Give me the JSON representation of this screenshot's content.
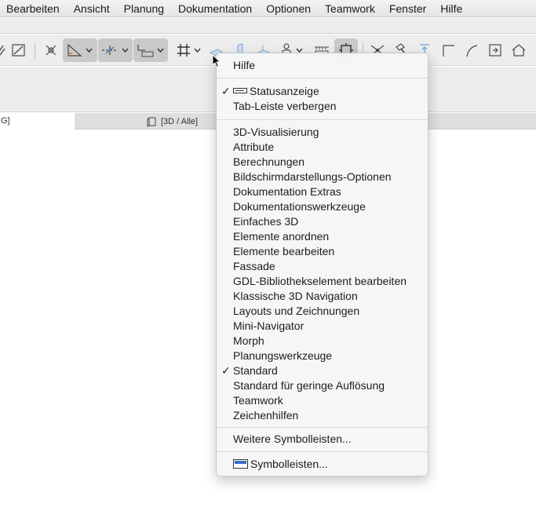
{
  "menubar": {
    "items": [
      "Bearbeiten",
      "Ansicht",
      "Planung",
      "Dokumentation",
      "Optionen",
      "Teamwork",
      "Fenster",
      "Hilfe"
    ]
  },
  "toolbar": {
    "icons": [
      "snap-guides-icon",
      "magic-wand-icon",
      "intersection-icon",
      "ruler-angle-icon",
      "guideline-icon",
      "coordinate-input-icon",
      "grid-snap-icon",
      "plane-icon",
      "vertical-plane-icon",
      "ortho-plane-icon",
      "person-icon",
      "measure-icon",
      "gravity-icon",
      "trim-icon",
      "hammer-icon",
      "elevate-icon",
      "corner-icon",
      "curve-icon",
      "export-icon",
      "home-icon"
    ]
  },
  "tabs": {
    "active_label": "G]",
    "view_label": "[3D / Alle]"
  },
  "menu": {
    "header": "Hilfe",
    "statusanzeige": "Statusanzeige",
    "tableiste": "Tab-Leiste verbergen",
    "toolbars": [
      "3D-Visualisierung",
      "Attribute",
      "Berechnungen",
      "Bildschirmdarstellungs-Optionen",
      "Dokumentation Extras",
      "Dokumentationswerkzeuge",
      "Einfaches 3D",
      "Elemente anordnen",
      "Elemente bearbeiten",
      "Fassade",
      "GDL-Bibliothekselement bearbeiten",
      "Klassische 3D Navigation",
      "Layouts und Zeichnungen",
      "Mini-Navigator",
      "Morph",
      "Planungswerkzeuge",
      "Standard",
      "Standard für geringe Auflösung",
      "Teamwork",
      "Zeichenhilfen"
    ],
    "weitere": "Weitere Symbolleisten...",
    "symbolleisten": "Symbolleisten...",
    "checked": [
      "Statusanzeige",
      "Standard"
    ],
    "checkmark": "✓"
  }
}
